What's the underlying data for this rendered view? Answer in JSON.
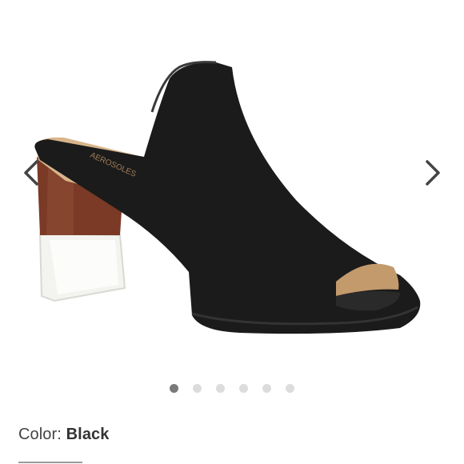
{
  "gallery": {
    "image": {
      "description_icon": "shoe-image",
      "insole_brand_text": "AEROSOLES"
    },
    "prev_arrow_icon": "chevron-left-icon",
    "next_arrow_icon": "chevron-right-icon",
    "slides_total": 6,
    "active_slide": 1
  },
  "product": {
    "color_label": "Color:",
    "color_value": "Black"
  },
  "colors": {
    "shoe": "#1b1b1b",
    "heel_wood": "#7a3a26",
    "heel_clear": "#f2f2ee",
    "dot_active": "#7a7a7a",
    "dot_inactive": "#dcdcdc",
    "arrow": "#444444"
  }
}
